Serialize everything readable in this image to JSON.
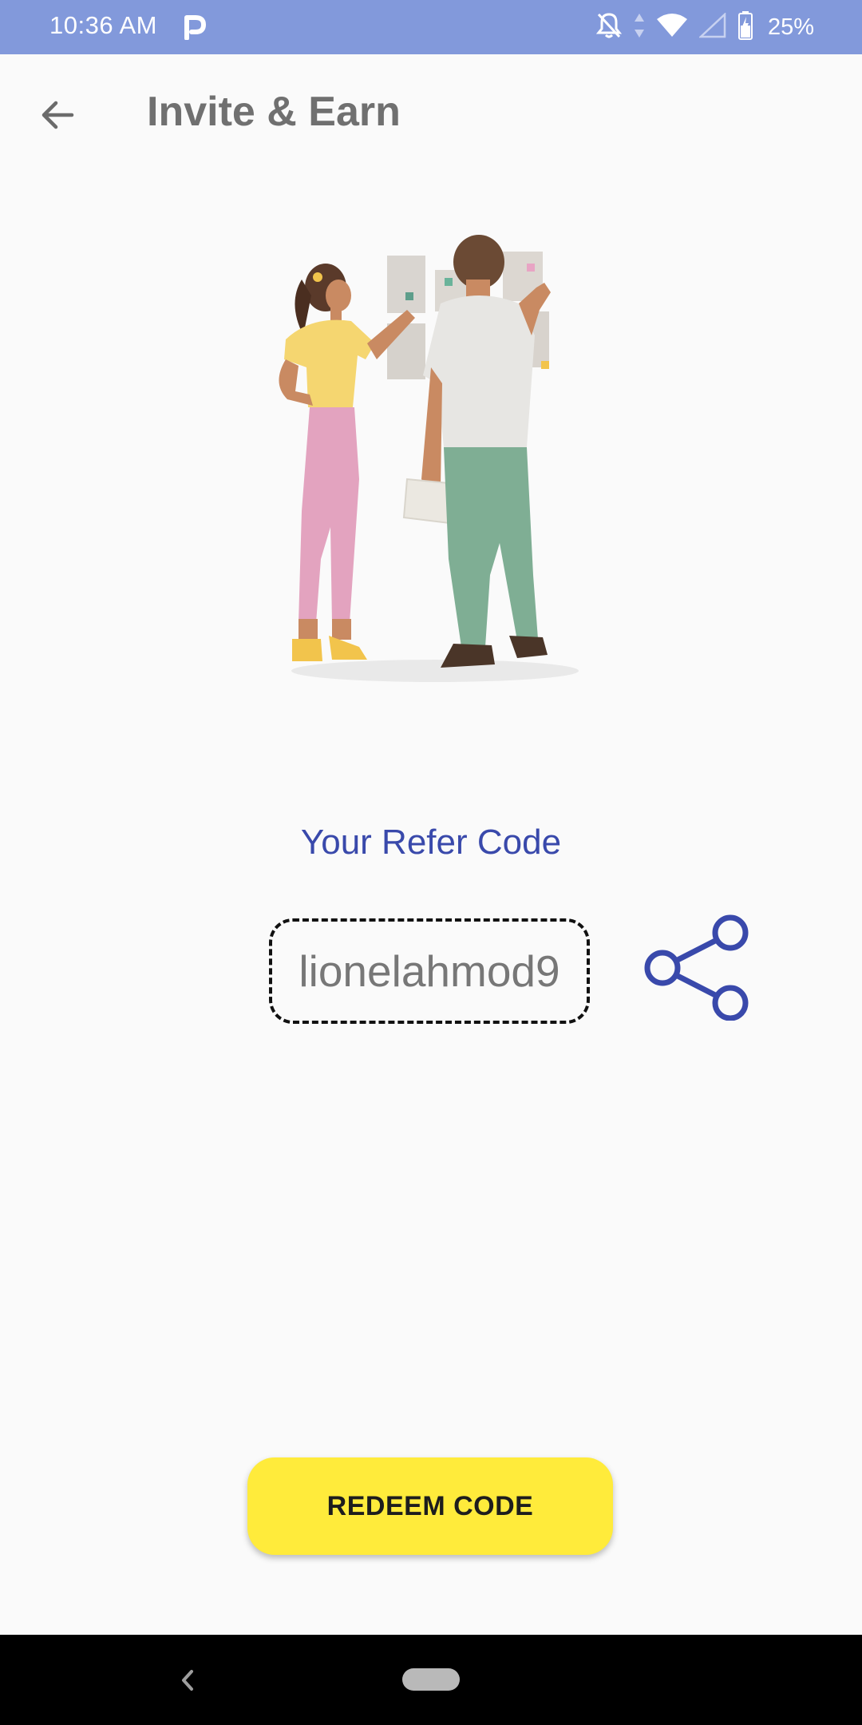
{
  "status_bar": {
    "time": "10:36 AM",
    "battery_percent": "25%",
    "icons": [
      "p-icon",
      "bell-off-icon",
      "data-arrows-icon",
      "wifi-icon",
      "signal-icon",
      "battery-icon"
    ]
  },
  "app_bar": {
    "title": "Invite & Earn",
    "back_icon": "arrow-left-icon"
  },
  "refer": {
    "label": "Your Refer Code",
    "code": "lionelahmod9",
    "share_icon": "share-icon"
  },
  "actions": {
    "redeem_label": "REDEEM CODE"
  },
  "colors": {
    "status_bar": "#8299db",
    "accent": "#3949ab",
    "button": "#ffeb3b",
    "background": "#fafafa"
  }
}
